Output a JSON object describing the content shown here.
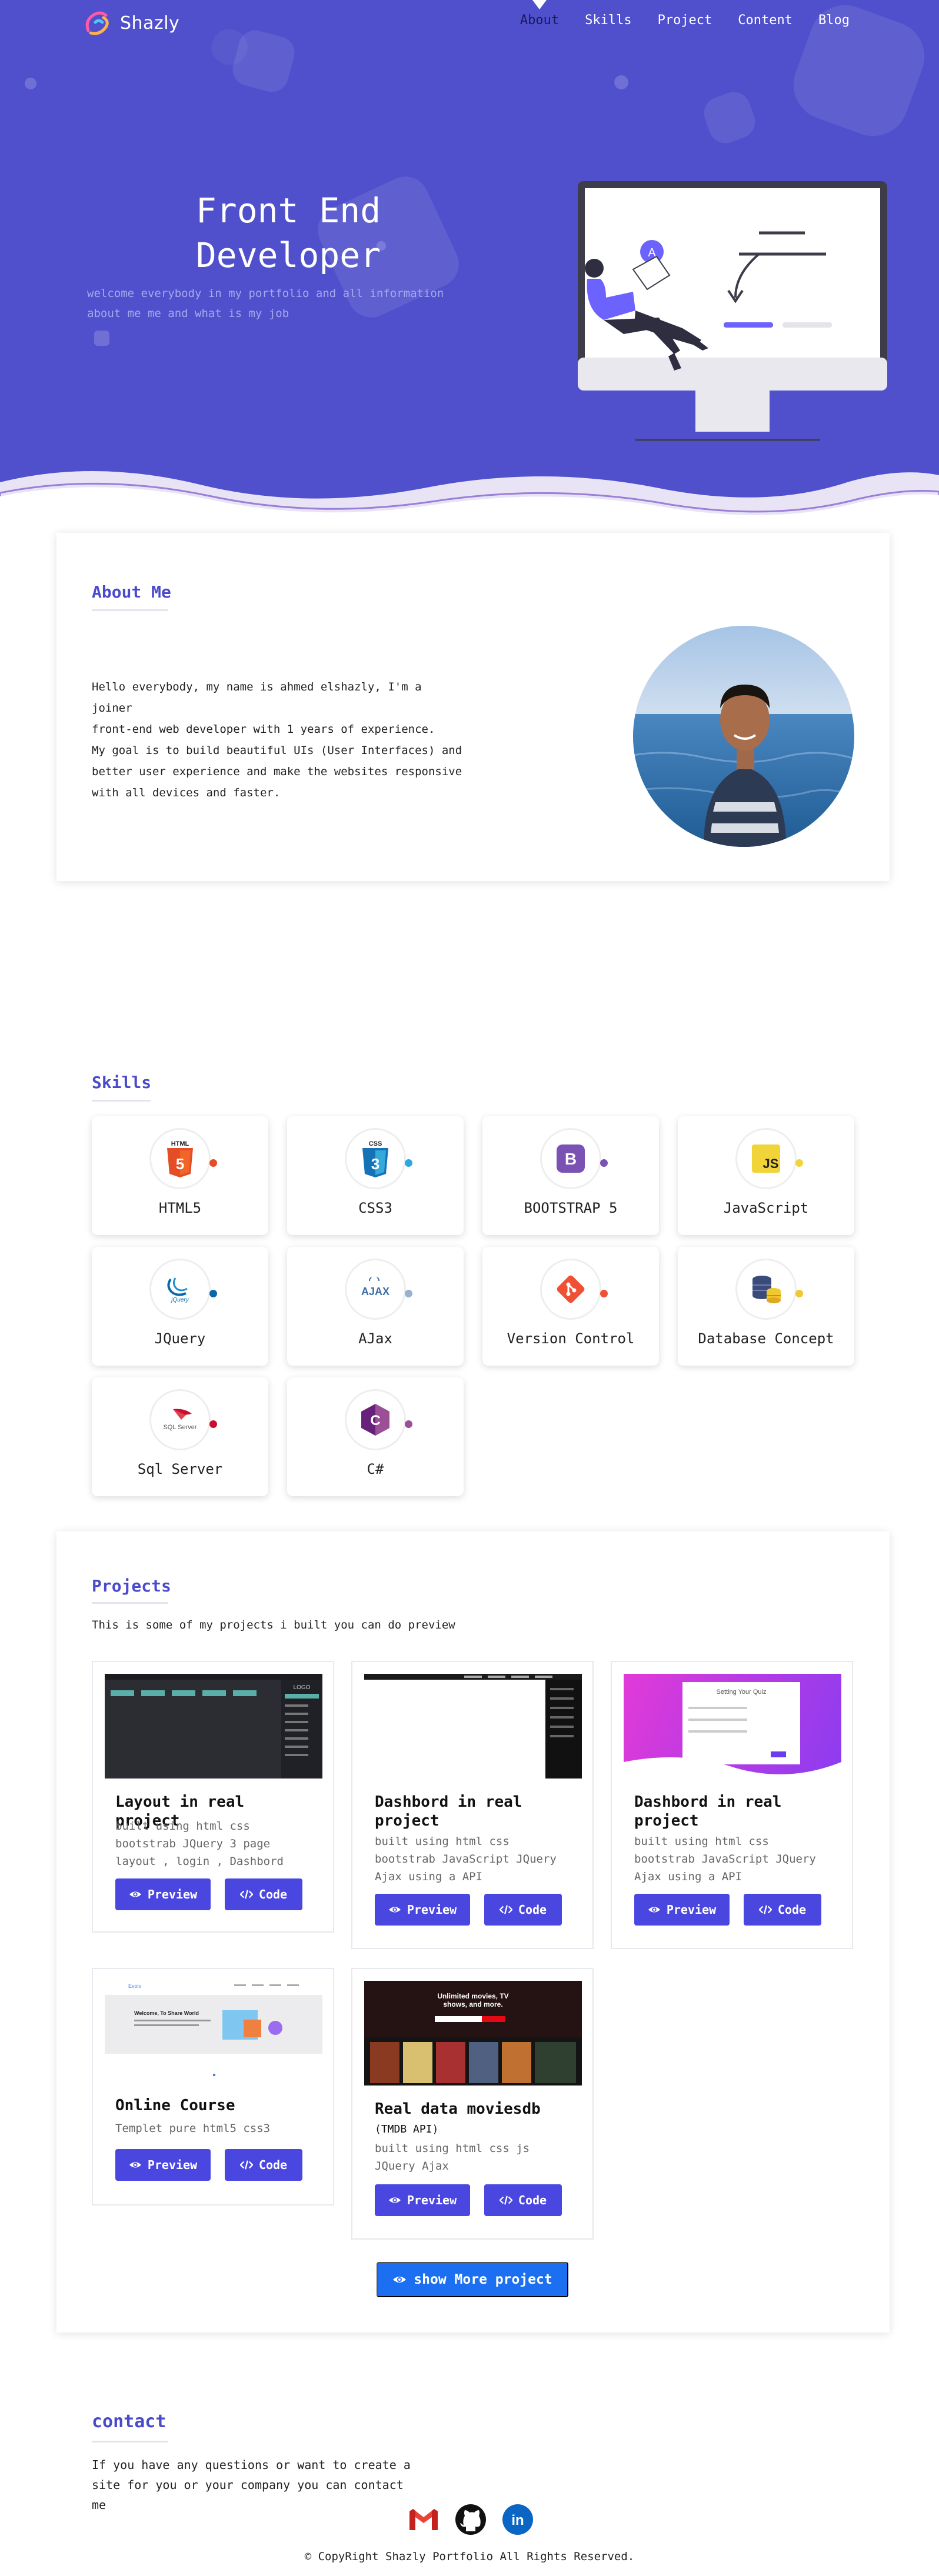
{
  "nav": {
    "brand": "Shazly",
    "links": [
      "About",
      "Skills",
      "Project",
      "Content",
      "Blog"
    ],
    "active": "About"
  },
  "hero": {
    "title_line1": "Front End",
    "title_line2": "Developer",
    "subtitle": "welcome everybody in my portfolio and all information about me me and what is my job",
    "illustration_badge": "A"
  },
  "about": {
    "heading": "About Me",
    "text_line1": "Hello everybody, my name is ahmed elshazly, I'm a joiner",
    "text_line2": "front-end web developer with 1 years of experience.",
    "text_line3": "My goal is to build beautiful UIs (User Interfaces) and",
    "text_line4": "better user experience and make the websites responsive",
    "text_line5": "with all devices and faster."
  },
  "skills": {
    "heading": "Skills",
    "items": [
      {
        "label": "HTML5",
        "icon": "html5-icon",
        "dot": "#e44d26"
      },
      {
        "label": "CSS3",
        "icon": "css3-icon",
        "dot": "#2aa8e0"
      },
      {
        "label": "BOOTSTRAP 5",
        "icon": "bootstrap-icon",
        "dot": "#7952b3"
      },
      {
        "label": "JavaScript",
        "icon": "javascript-icon",
        "dot": "#f0d43a"
      },
      {
        "label": "JQuery",
        "icon": "jquery-icon",
        "dot": "#0868ac"
      },
      {
        "label": "AJax",
        "icon": "ajax-icon",
        "dot": "#9ab0d0"
      },
      {
        "label": "Version Control",
        "icon": "git-icon",
        "dot": "#f05033"
      },
      {
        "label": "Database Concept",
        "icon": "database-icon",
        "dot": "#f0c830"
      },
      {
        "label": "Sql Server",
        "icon": "sqlserver-icon",
        "dot": "#c8102e"
      },
      {
        "label": "C#",
        "icon": "csharp-icon",
        "dot": "#9b4f96"
      }
    ]
  },
  "projects": {
    "heading": "Projects",
    "description": "This is some of my projects i built you can do preview",
    "preview_label": "Preview",
    "code_label": "Code",
    "more_label": "show More project",
    "items": [
      {
        "title": "Layout in real project",
        "body1": "built using html css",
        "body2": "bootstrab JQuery 3 page",
        "body3": "layout , login , Dashbord"
      },
      {
        "title": "Dashbord in real project",
        "body1": "built using html css",
        "body2": "bootstrab JavaScript JQuery",
        "body3": "Ajax using a API"
      },
      {
        "title": "Dashbord in real project",
        "body1": "built using html css",
        "body2": "bootstrab JavaScript JQuery",
        "body3": "Ajax using a API"
      },
      {
        "title": "Online Course",
        "body1": "Templet pure html5 css3",
        "body2": "",
        "body3": ""
      },
      {
        "title": "Real data moviesdb",
        "title_small": "(TMDB API)",
        "body1": "built using html css js",
        "body2": "JQuery Ajax",
        "body3": ""
      }
    ]
  },
  "contact": {
    "heading": "contact",
    "text_line1": "If you have any questions or want to create a",
    "text_line2": "site for you or your company you can contact me",
    "socials": [
      "gmail-icon",
      "github-icon",
      "linkedin-icon"
    ]
  },
  "footer": {
    "copyright": "© CopyRight Shazly Portfolio All Rights Reserved."
  }
}
